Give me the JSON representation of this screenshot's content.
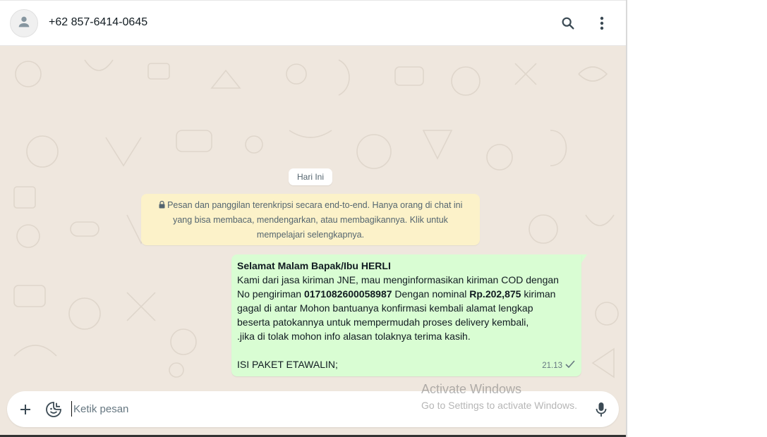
{
  "header": {
    "contact_name": "+62 857-6414-0645",
    "avatar_icon": "person-icon",
    "search_icon": "search-icon",
    "menu_icon": "more-vertical-icon"
  },
  "chat": {
    "date_label": "Hari Ini",
    "encryption_notice": {
      "lock_icon": "lock-icon",
      "line1": "Pesan dan panggilan terenkripsi secara end-to-end. Hanya orang di chat ini",
      "line2": "yang bisa membaca, mendengarkan, atau membagikannya. Klik untuk",
      "line3": "mempelajari selengkapnya."
    },
    "message": {
      "greeting": "Selamat Malam Bapak/Ibu HERLI",
      "line1": "Kami dari jasa kiriman JNE, mau menginformasikan kiriman COD dengan",
      "line2_prefix": "No pengiriman ",
      "tracking_number": "0171082600058987",
      "line2_middle": " Dengan nominal ",
      "amount": "Rp.202,875",
      "line2_suffix": " kiriman",
      "line3": "gagal di antar Mohon bantuanya konfirmasi kembali alamat lengkap",
      "line4": "beserta patokannya untuk mempermudah proses delivery kembali,",
      "line5": " .jika di tolak mohon info alasan tolaknya terima kasih.",
      "line6": "ISI PAKET ETAWALIN;",
      "time": "21.13",
      "status_icon": "single-check-icon"
    }
  },
  "composer": {
    "attach_icon": "plus-icon",
    "sticker_icon": "sticker-icon",
    "placeholder": "Ketik pesan",
    "mic_icon": "microphone-icon"
  },
  "watermark": {
    "title": "Activate Windows",
    "subtitle": "Go to Settings to activate Windows."
  },
  "colors": {
    "chat_background": "#efe7de",
    "outgoing_bubble": "#d9fdd3",
    "notice_background": "#fcf2c9"
  }
}
